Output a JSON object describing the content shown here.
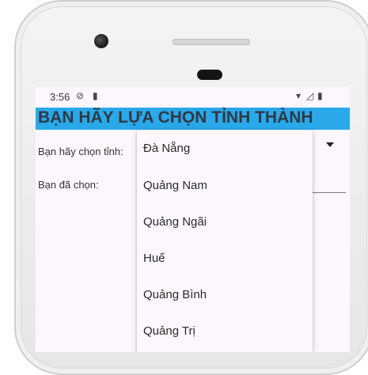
{
  "statusbar": {
    "time": "3:56",
    "icons": [
      "shield-icon",
      "sd-card-icon",
      "wifi-icon",
      "signal-icon",
      "battery-icon"
    ]
  },
  "header": {
    "title": "BẠN HÃY LỰA CHỌN TỈNH THÀNH",
    "color": "#29a8ea"
  },
  "form": {
    "choose_label": "Bạn hãy chọn tỉnh:",
    "chosen_label": "Bạn đã chọn:"
  },
  "dropdown": {
    "options": [
      "Đà Nẵng",
      "Quảng Nam",
      "Quảng Ngãi",
      "Huế",
      "Quảng Bình",
      "Quảng Trị"
    ]
  }
}
